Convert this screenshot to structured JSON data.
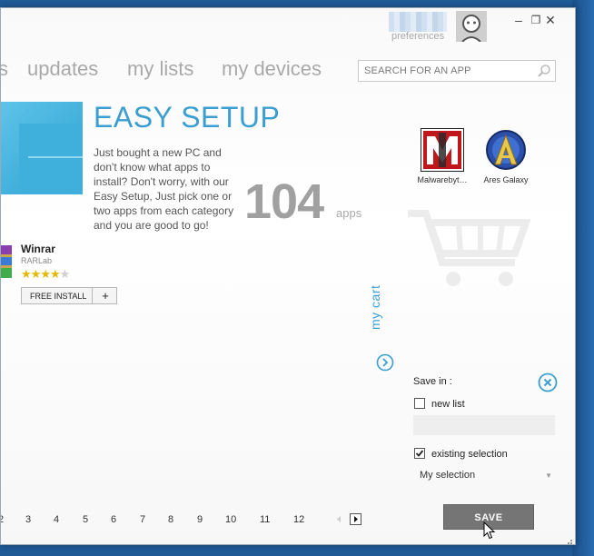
{
  "header": {
    "preferences_label": "preferences",
    "nav": [
      {
        "label": "s"
      },
      {
        "label": "updates"
      },
      {
        "label": "my lists"
      },
      {
        "label": "my devices"
      }
    ],
    "search_placeholder": "SEARCH FOR AN APP"
  },
  "window_controls": {
    "minimize": "–",
    "maximize": "❐",
    "close": "✕"
  },
  "easy_setup": {
    "title": "EASY SETUP",
    "description": "Just bought a new PC and don't know what apps to install? Don't worry, with our Easy Setup, Just pick one or two apps from each category and you are good to go!",
    "count": "104",
    "count_label": "apps"
  },
  "featured_app": {
    "name": "Winrar",
    "publisher": "RARLab",
    "rating": 4,
    "rating_max": 5,
    "install_label": "FREE INSTALL",
    "add_label": "+"
  },
  "cart": {
    "label": "my cart",
    "items": [
      {
        "name": "Malwarebyt…"
      },
      {
        "name": "Ares Galaxy"
      }
    ]
  },
  "save_panel": {
    "save_in_label": "Save in :",
    "new_list_label": "new list",
    "new_list_checked": false,
    "existing_label": "existing selection",
    "existing_checked": true,
    "selected_list": "My selection",
    "save_label": "SAVE"
  },
  "pagination": {
    "pages": [
      "2",
      "3",
      "4",
      "5",
      "6",
      "7",
      "8",
      "9",
      "10",
      "11",
      "12"
    ]
  },
  "colors": {
    "accent": "#3a9fd0",
    "save_button": "#757575",
    "star": "#e2b900"
  }
}
